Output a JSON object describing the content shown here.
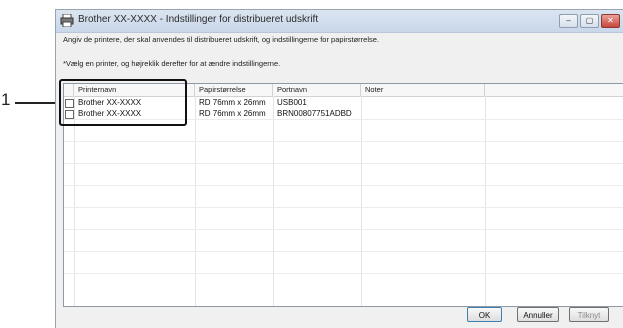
{
  "callout": {
    "number": "1"
  },
  "window": {
    "title": "Brother XX-XXXX - Indstillinger for distribueret udskrift",
    "controls": [
      "–",
      "▢",
      "✕"
    ]
  },
  "instructions": {
    "line1": "Angiv de printere, der skal anvendes til distribueret udskrift, og indstillingerne for papirstørrelse.",
    "line2": "*Vælg en printer, og højreklik derefter for at ændre indstillingerne."
  },
  "table": {
    "columns": [
      "Printernavn",
      "Papirstørrelse",
      "Portnavn",
      "Noter"
    ],
    "rows": [
      {
        "checked": false,
        "printer": "Brother XX-XXXX",
        "paper": "RD 76mm x 26mm",
        "port": "USB001",
        "notes": ""
      },
      {
        "checked": false,
        "printer": "Brother XX-XXXX",
        "paper": "RD 76mm x 26mm",
        "port": "BRN00807751ADBD",
        "notes": ""
      }
    ]
  },
  "buttons": {
    "ok": "OK",
    "cancel": "Annuller",
    "apply": "Tilknyt"
  },
  "colors": {
    "titlebar": "#c9d7ea",
    "close": "#c8453a",
    "highlight": "#111111"
  }
}
